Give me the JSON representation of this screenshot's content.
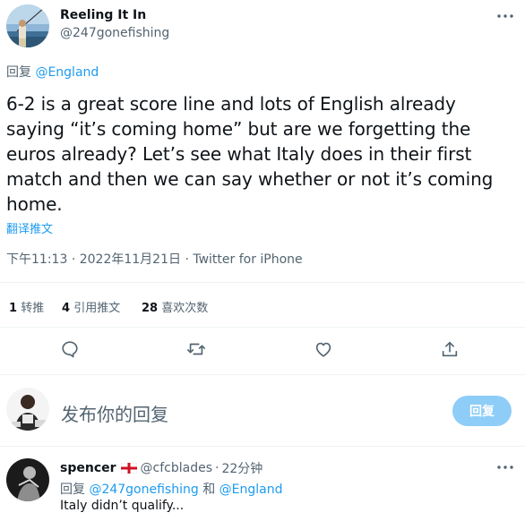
{
  "tweet": {
    "author_name": "Reeling It In",
    "author_handle": "@247gonefishing",
    "reply_prefix": "回复",
    "reply_to": "@England",
    "text": "6-2 is a great score line and lots of English already saying “it’s coming home” but are we forgetting the euros already? Let’s see what Italy does in their first match and then we can say whether or not it’s coming home.",
    "translate_label": "翻译推文",
    "time": "下午11:13",
    "date": "2022年11月21日",
    "separator": "·",
    "source": "Twitter for iPhone"
  },
  "stats": {
    "retweets_count": "1",
    "retweets_label": "转推",
    "quotes_count": "4",
    "quotes_label": "引用推文",
    "likes_count": "28",
    "likes_label": "喜欢次数"
  },
  "actions": [
    "reply-icon",
    "retweet-icon",
    "like-icon",
    "share-icon"
  ],
  "composer": {
    "placeholder": "发布你的回复",
    "button_label": "回复"
  },
  "reply": {
    "author_name": "spencer",
    "flag": "england-flag-icon",
    "author_handle": "@cfcblades",
    "separator": "·",
    "time_ago": "22分钟",
    "reply_prefix": "回复",
    "reply_to_1": "@247gonefishing",
    "conjunction": "和",
    "reply_to_2": "@England",
    "text": "Italy didn’t qualify..."
  },
  "colors": {
    "accent": "#1d9bf0",
    "muted_text": "#536471",
    "button_disabled": "#8ecdf8",
    "divider": "#eff3f4"
  }
}
